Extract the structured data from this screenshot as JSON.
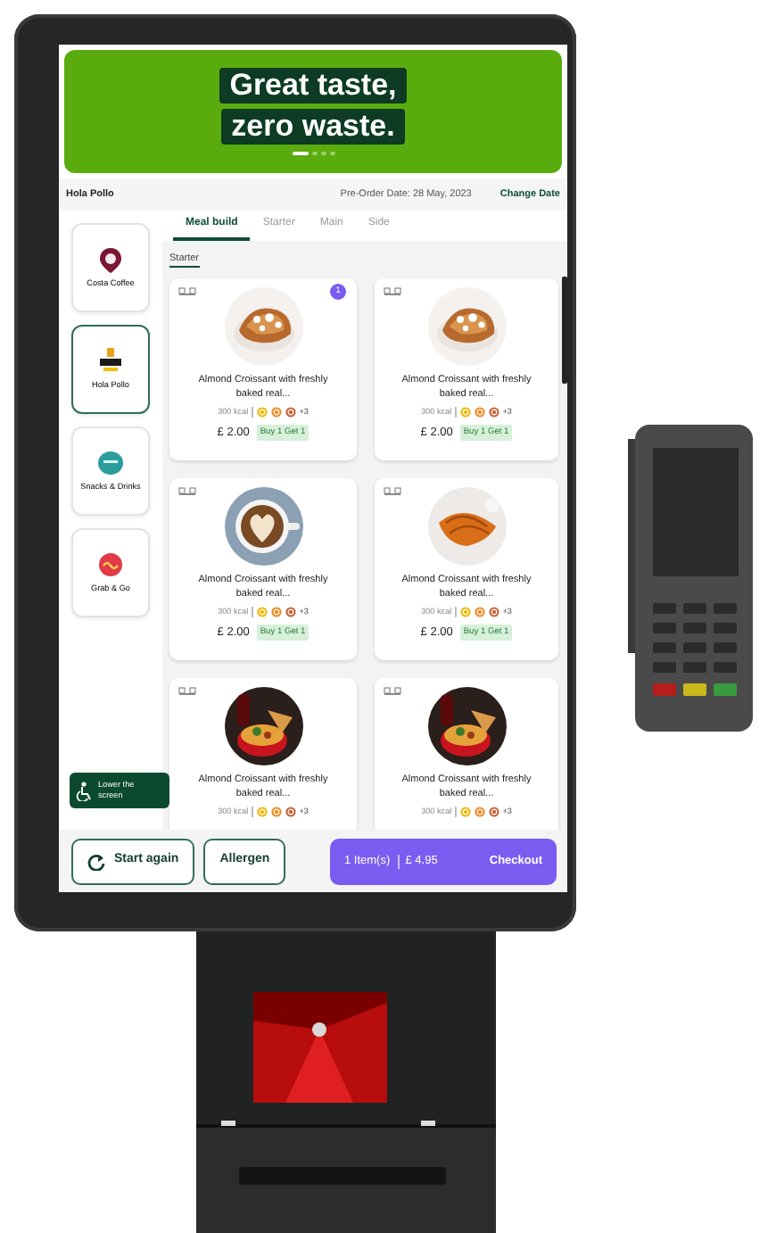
{
  "banner": {
    "lines": [
      "Great taste,",
      "zero waste."
    ],
    "pages": [
      {
        "selected": true
      },
      {
        "selected": false
      },
      {
        "selected": false
      },
      {
        "selected": false
      }
    ]
  },
  "header": {
    "store": "Hola Pollo",
    "preorder_date": "Pre-Order Date: 28 May, 2023",
    "change_date": "Change Date"
  },
  "sidebar": {
    "items": [
      {
        "label": "Costa Coffee",
        "selected": false
      },
      {
        "label": "Hola Pollo",
        "selected": true
      },
      {
        "label": "Snacks & Drinks",
        "selected": false
      },
      {
        "label": "Grab & Go",
        "selected": false
      }
    ]
  },
  "tabs": [
    {
      "label": "Meal build",
      "selected": true
    },
    {
      "label": "Starter",
      "selected": false
    },
    {
      "label": "Main",
      "selected": false
    },
    {
      "label": "Side",
      "selected": false
    }
  ],
  "section": "Starter",
  "products": [
    {
      "title": "Almond Croissant with freshly baked real...",
      "kcal": "300 kcal",
      "more_allergens": "+3",
      "price": "£ 2.00",
      "offer": "Buy 1 Get 1",
      "count": "1"
    },
    {
      "title": "Almond Croissant with freshly baked real...",
      "kcal": "300 kcal",
      "more_allergens": "+3",
      "price": "£ 2.00",
      "offer": "Buy 1 Get 1"
    },
    {
      "title": "Almond Croissant with freshly baked real...",
      "kcal": "300 kcal",
      "more_allergens": "+3",
      "price": "£ 2.00",
      "offer": "Buy 1 Get 1"
    },
    {
      "title": "Almond Croissant with freshly baked real...",
      "kcal": "300 kcal",
      "more_allergens": "+3",
      "price": "£ 2.00",
      "offer": "Buy 1 Get 1"
    },
    {
      "title": "Almond Croissant with freshly baked real...",
      "kcal": "300 kcal",
      "more_allergens": "+3"
    },
    {
      "title": "Almond Croissant with freshly baked real...",
      "kcal": "300 kcal",
      "more_allergens": "+3"
    }
  ],
  "lower_screen": "Lower the screen",
  "footer": {
    "start_again": "Start again",
    "allergen": "Allergen",
    "checkout": {
      "items": "1 Item(s)",
      "total": "£ 4.95",
      "label": "Checkout"
    }
  }
}
